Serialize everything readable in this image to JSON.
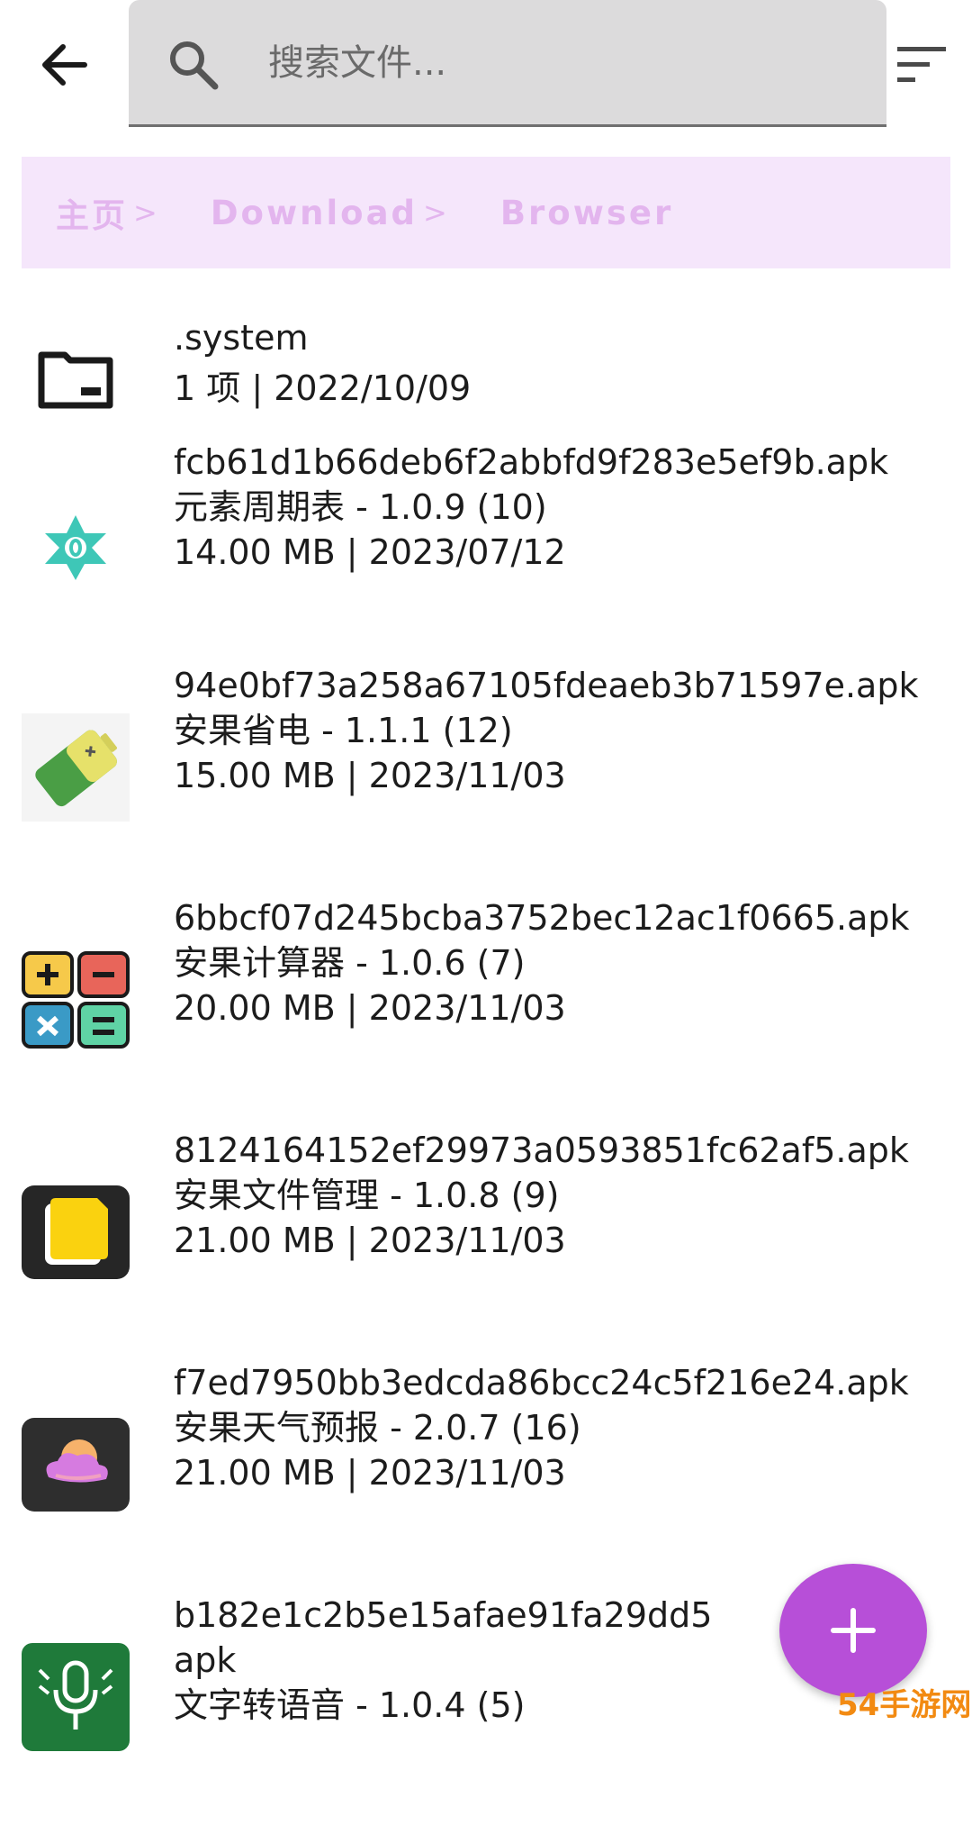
{
  "search": {
    "placeholder": "搜索文件..."
  },
  "breadcrumb": {
    "items": [
      {
        "label": "主页",
        "sep": ">"
      },
      {
        "label": "Download",
        "sep": ">"
      },
      {
        "label": "Browser",
        "sep": ""
      }
    ]
  },
  "files": [
    {
      "icon": "folder-icon",
      "name": ".system",
      "meta": "1 项 | 2022/10/09"
    },
    {
      "icon": "periodic-table-app-icon",
      "name": "fcb61d1b66deb6f2abbfd9f283e5ef9b.apk",
      "app": "元素周期表 - 1.0.9 (10)",
      "meta": "14.00 MB | 2023/07/12"
    },
    {
      "icon": "battery-saver-app-icon",
      "name": "94e0bf73a258a67105fdeaeb3b71597e.apk",
      "app": "安果省电 - 1.1.1 (12)",
      "meta": "15.00 MB | 2023/11/03"
    },
    {
      "icon": "calculator-app-icon",
      "name": "6bbcf07d245bcba3752bec12ac1f0665.apk",
      "app": "安果计算器 - 1.0.6 (7)",
      "meta": "20.00 MB | 2023/11/03"
    },
    {
      "icon": "file-manager-app-icon",
      "name": "8124164152ef29973a0593851fc62af5.apk",
      "app": "安果文件管理 - 1.0.8 (9)",
      "meta": "21.00 MB | 2023/11/03"
    },
    {
      "icon": "weather-app-icon",
      "name": "f7ed7950bb3edcda86bcc24c5f216e24.apk",
      "app": "安果天气预报 - 2.0.7 (16)",
      "meta": "21.00 MB | 2023/11/03"
    },
    {
      "icon": "text-to-speech-app-icon",
      "name": "b182e1c2b5e15afae91fa29dd5",
      "name2": "apk",
      "app": "文字转语音 - 1.0.4 (5)"
    }
  ],
  "fab": {
    "icon": "plus-icon"
  },
  "watermark": {
    "text": "54手游网"
  },
  "colors": {
    "accent": "#b74fd8",
    "breadcrumb_bg": "#f5e6fb",
    "breadcrumb_text": "#e3b5ee",
    "search_bg": "#dcdbdc"
  }
}
